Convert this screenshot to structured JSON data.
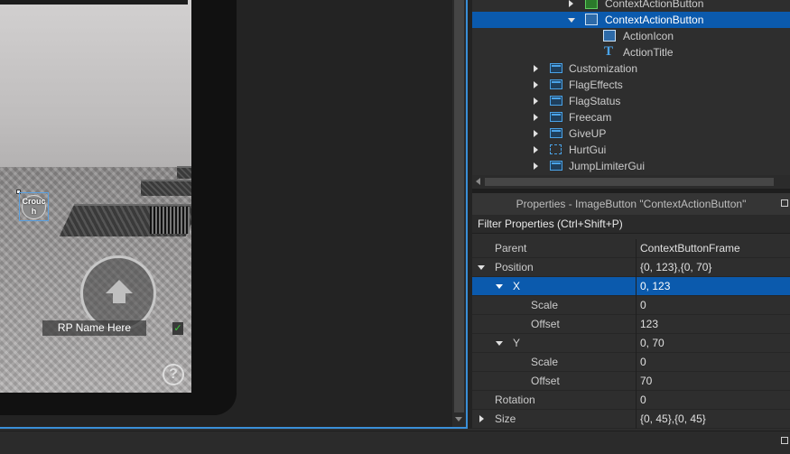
{
  "viewport": {
    "crouch_button_label": "Crouc h",
    "rp_name": "RP Name Here",
    "rp_check": "✓",
    "help_glyph": "?"
  },
  "explorer": {
    "items": [
      {
        "label": "ContextActionButton",
        "icon": "image-button-icon-green",
        "expand": "right",
        "selected": false
      },
      {
        "label": "ContextActionButton",
        "icon": "image-button-icon",
        "expand": "down",
        "selected": true
      },
      {
        "label": "ActionIcon",
        "icon": "image-label-icon",
        "expand": "none",
        "selected": false
      },
      {
        "label": "ActionTitle",
        "icon": "text-label-icon",
        "expand": "none",
        "selected": false
      },
      {
        "label": "Customization",
        "icon": "screen-gui-icon",
        "expand": "right",
        "selected": false
      },
      {
        "label": "FlagEffects",
        "icon": "screen-gui-icon",
        "expand": "right",
        "selected": false
      },
      {
        "label": "FlagStatus",
        "icon": "screen-gui-icon",
        "expand": "right",
        "selected": false
      },
      {
        "label": "Freecam",
        "icon": "screen-gui-icon",
        "expand": "right",
        "selected": false
      },
      {
        "label": "GiveUP",
        "icon": "screen-gui-icon",
        "expand": "right",
        "selected": false
      },
      {
        "label": "HurtGui",
        "icon": "frame-icon",
        "expand": "right",
        "selected": false
      },
      {
        "label": "JumpLimiterGui",
        "icon": "screen-gui-icon",
        "expand": "right",
        "selected": false
      }
    ]
  },
  "properties": {
    "title": "Properties - ImageButton \"ContextActionButton\"",
    "filter_placeholder": "Filter Properties (Ctrl+Shift+P)",
    "rows": [
      {
        "name": "Parent",
        "value": "ContextButtonFrame",
        "expand": "none",
        "depth": 0,
        "selected": false
      },
      {
        "name": "Position",
        "value": "{0, 123},{0, 70}",
        "expand": "down",
        "depth": 0,
        "selected": false
      },
      {
        "name": "X",
        "value": "0, 123",
        "expand": "down",
        "depth": 1,
        "selected": true
      },
      {
        "name": "Scale",
        "value": "0",
        "expand": "none",
        "depth": 2,
        "selected": false
      },
      {
        "name": "Offset",
        "value": "123",
        "expand": "none",
        "depth": 2,
        "selected": false
      },
      {
        "name": "Y",
        "value": "0, 70",
        "expand": "down",
        "depth": 1,
        "selected": false
      },
      {
        "name": "Scale",
        "value": "0",
        "expand": "none",
        "depth": 2,
        "selected": false
      },
      {
        "name": "Offset",
        "value": "70",
        "expand": "none",
        "depth": 2,
        "selected": false
      },
      {
        "name": "Rotation",
        "value": "0",
        "expand": "none",
        "depth": 0,
        "selected": false
      },
      {
        "name": "Size",
        "value": "{0, 45},{0, 45}",
        "expand": "right",
        "depth": 0,
        "selected": false
      }
    ]
  },
  "colors": {
    "selection": "#0b5aad",
    "viewport_border": "#3a8fd8",
    "panel_bg": "#2e2e2e"
  }
}
